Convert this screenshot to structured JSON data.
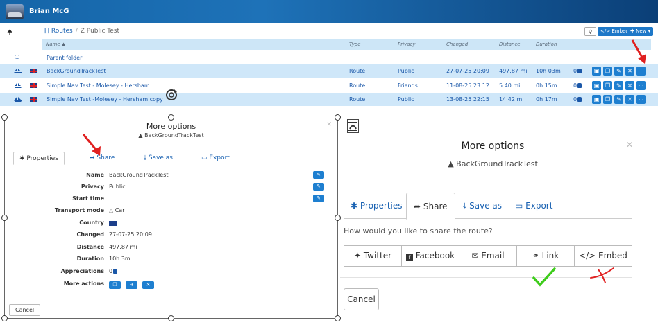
{
  "header": {
    "username": "Brian McG"
  },
  "breadcrumb": {
    "root": "Routes",
    "separator": "/",
    "current": "Z Public Test"
  },
  "toolbar": {
    "embed_label": "Embed",
    "new_label": "New"
  },
  "table": {
    "columns": {
      "name": "Name",
      "type": "Type",
      "privacy": "Privacy",
      "changed": "Changed",
      "distance": "Distance",
      "duration": "Duration"
    },
    "parent_folder_label": "Parent folder",
    "rows": [
      {
        "name": "BackGroundTrackTest",
        "type": "Route",
        "privacy": "Public",
        "changed": "27-07-25 20:09",
        "distance": "497.87 mi",
        "duration": "10h 03m",
        "appreciations": "0"
      },
      {
        "name": "Simple Nav Test - Molesey - Hersham",
        "type": "Route",
        "privacy": "Friends",
        "changed": "11-08-25 23:12",
        "distance": "5.40 mi",
        "duration": "0h 15m",
        "appreciations": "0"
      },
      {
        "name": "Simple Nav Test -Molesey - Hersham copy",
        "type": "Route",
        "privacy": "Public",
        "changed": "13-08-25 22:15",
        "distance": "14.42 mi",
        "duration": "0h 17m",
        "appreciations": "0"
      }
    ]
  },
  "left_modal": {
    "title": "More options",
    "subtitle": "BackGroundTrackTest",
    "tabs": [
      "Properties",
      "Share",
      "Save as",
      "Export"
    ],
    "fields": [
      {
        "label": "Name",
        "value": "BackGroundTrackTest"
      },
      {
        "label": "Privacy",
        "value": "Public"
      },
      {
        "label": "Start time",
        "value": ""
      },
      {
        "label": "Transport mode",
        "value": "Car"
      },
      {
        "label": "Country",
        "value": ""
      },
      {
        "label": "Changed",
        "value": "27-07-25 20:09"
      },
      {
        "label": "Distance",
        "value": "497.87 mi"
      },
      {
        "label": "Duration",
        "value": "10h 3m"
      },
      {
        "label": "Appreciations",
        "value": "0"
      },
      {
        "label": "More actions",
        "value": ""
      }
    ],
    "cancel_label": "Cancel"
  },
  "right_modal": {
    "title": "More options",
    "subtitle": "BackGroundTrackTest",
    "tabs": [
      "Properties",
      "Share",
      "Save as",
      "Export"
    ],
    "question": "How would you like to share the route?",
    "share_buttons": [
      "Twitter",
      "Facebook",
      "Email",
      "Link",
      "Embed"
    ],
    "cancel_label": "Cancel"
  },
  "colors": {
    "header_blue": "#1565a8",
    "button_blue": "#1e7fd0",
    "link_blue": "#1a62b2",
    "annotation_red": "#e02020",
    "annotation_green": "#3dcc1a"
  }
}
